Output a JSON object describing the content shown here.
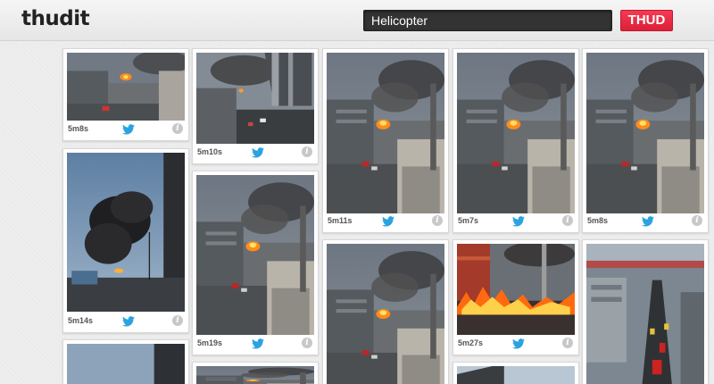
{
  "header": {
    "logo": "thudit",
    "search_value": "Helicopter",
    "search_button": "THUD"
  },
  "cards": [
    {
      "time": "5m8s",
      "scene": "crane-fire-small"
    },
    {
      "time": "5m10s",
      "scene": "tower-smoke"
    },
    {
      "time": "5m11s",
      "scene": "crane-fire"
    },
    {
      "time": "5m7s",
      "scene": "crane-fire"
    },
    {
      "time": "5m8s",
      "scene": "crane-fire"
    },
    {
      "time": "5m14s",
      "scene": "black-smoke-dusk"
    },
    {
      "time": "5m19s",
      "scene": "crane-fire"
    },
    {
      "time": "5m27s",
      "scene": "street-flames"
    },
    {
      "time": "",
      "scene": "crane-fire"
    },
    {
      "time": "",
      "scene": "aerial-road"
    },
    {
      "time": "",
      "scene": "sky"
    },
    {
      "time": "",
      "scene": "crane-fire"
    },
    {
      "time": "",
      "scene": "sky-building"
    }
  ],
  "icons": {
    "twitter": "twitter-bird-icon",
    "info": "info-icon"
  },
  "info_glyph": "i",
  "colors": {
    "accent": "#e8233d",
    "twitter": "#2aa3e0"
  }
}
